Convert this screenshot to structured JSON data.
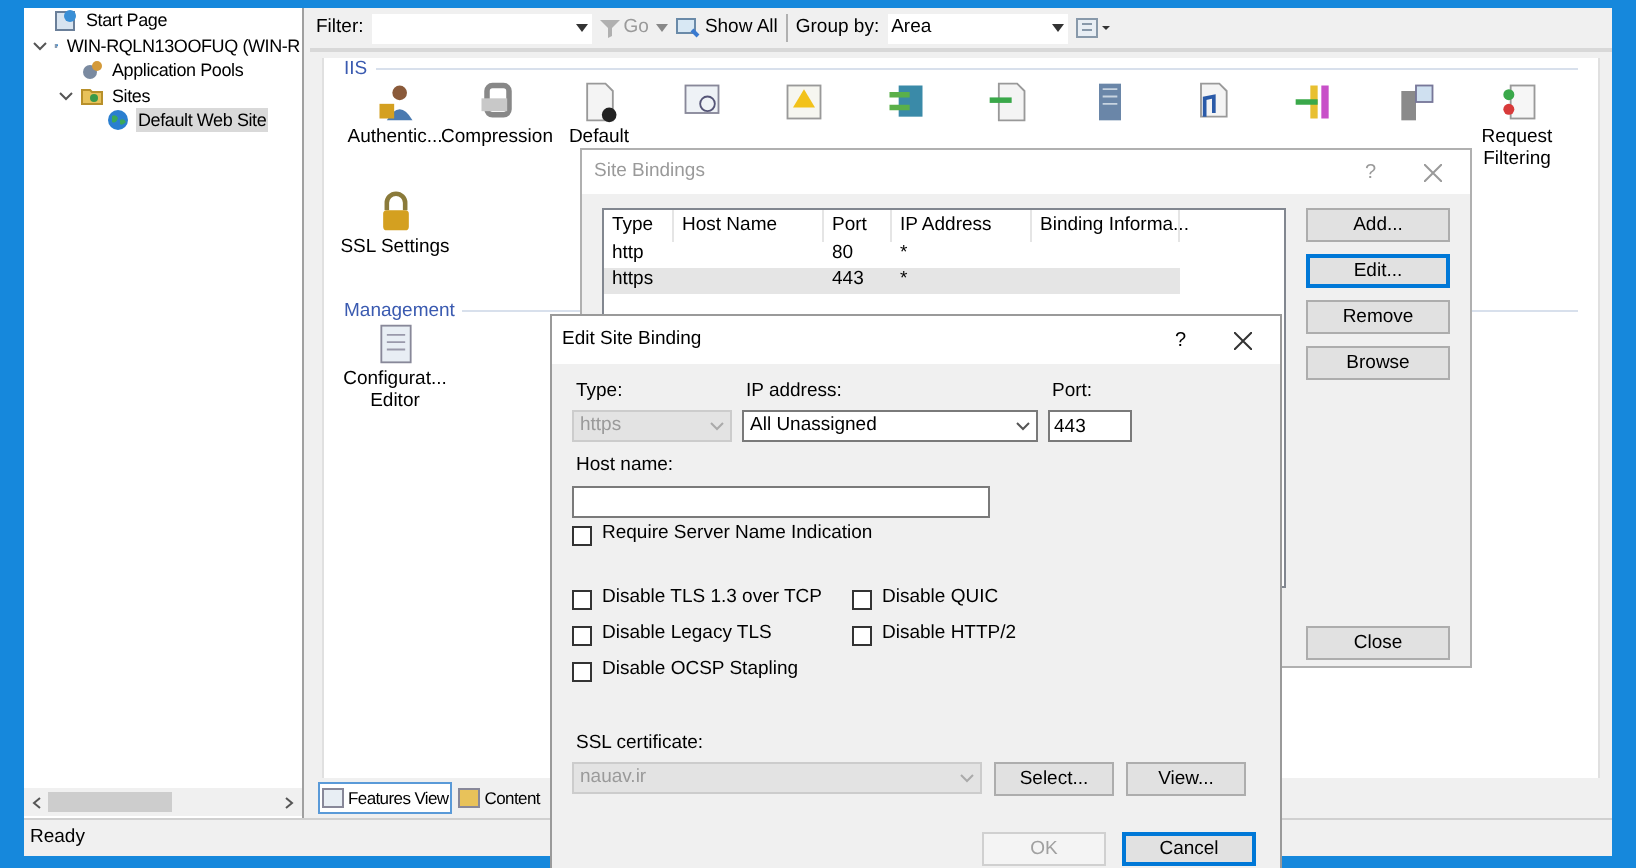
{
  "tree": {
    "items": [
      {
        "label": "Start Page",
        "selected": false
      },
      {
        "label": "WIN-RQLN13OOFUQ (WIN-R",
        "expanded": true,
        "selected": false,
        "children": [
          {
            "label": "Application Pools",
            "selected": false
          },
          {
            "label": "Sites",
            "expanded": true,
            "selected": false,
            "children": [
              {
                "label": "Default Web Site",
                "selected": true
              }
            ]
          }
        ]
      }
    ]
  },
  "toolbar": {
    "filter_label": "Filter:",
    "go": "Go",
    "show_all": "Show All",
    "group_by_label": "Group by:",
    "group_by_value": "Area"
  },
  "sections": [
    {
      "title": "IIS",
      "features": [
        {
          "kind": "labeled",
          "label": "Authentic..."
        },
        {
          "kind": "labeled",
          "label": "Compression"
        },
        {
          "kind": "labeled",
          "label": "Default"
        },
        {
          "kind": "covered"
        },
        {
          "kind": "covered"
        },
        {
          "kind": "covered"
        },
        {
          "kind": "covered"
        },
        {
          "kind": "covered"
        },
        {
          "kind": "covered"
        },
        {
          "kind": "covered"
        },
        {
          "kind": "covered"
        },
        {
          "kind": "labeled",
          "label": "Request Filtering"
        },
        {
          "kind": "labeled",
          "label": "SSL Settings"
        }
      ]
    },
    {
      "title": "Management",
      "features": [
        {
          "kind": "labeled",
          "label": "Configurat... Editor"
        }
      ]
    }
  ],
  "view_tabs": [
    {
      "label": "Features View",
      "selected": true
    },
    {
      "label": "Content",
      "selected": false
    }
  ],
  "status_bar": "Ready",
  "site_bindings": {
    "title": "Site Bindings",
    "help": "?",
    "columns": [
      "Type",
      "Host Name",
      "Port",
      "IP Address",
      "Binding Informa..."
    ],
    "rows": [
      {
        "cells": [
          "http",
          "",
          "80",
          "*",
          ""
        ],
        "selected": false
      },
      {
        "cells": [
          "https",
          "",
          "443",
          "*",
          ""
        ],
        "selected": true
      }
    ],
    "buttons": [
      {
        "label": "Add...",
        "focused": false
      },
      {
        "label": "Edit...",
        "focused": true
      },
      {
        "label": "Remove",
        "focused": false
      },
      {
        "label": "Browse",
        "focused": false
      }
    ],
    "close": "Close"
  },
  "edit_binding": {
    "title": "Edit Site Binding",
    "help": "?",
    "type": {
      "label": "Type:",
      "value": "https",
      "disabled": true
    },
    "ip": {
      "label": "IP address:",
      "value": "All Unassigned"
    },
    "port": {
      "label": "Port:",
      "value": "443"
    },
    "host": {
      "label": "Host name:"
    },
    "sni": {
      "label": "Require Server Name Indication",
      "checked": false
    },
    "options": [
      {
        "label": "Disable TLS 1.3 over TCP",
        "checked": false
      },
      {
        "label": "Disable QUIC",
        "checked": false
      },
      {
        "label": "Disable Legacy TLS",
        "checked": false
      },
      {
        "label": "Disable HTTP/2",
        "checked": false
      },
      {
        "label": "Disable OCSP Stapling",
        "checked": false
      }
    ],
    "ssl": {
      "label": "SSL certificate:",
      "value": "nauav.ir"
    },
    "select": "Select...",
    "view": "View...",
    "ok": {
      "label": "OK",
      "disabled": true
    },
    "cancel": {
      "label": "Cancel",
      "focused": true
    }
  }
}
